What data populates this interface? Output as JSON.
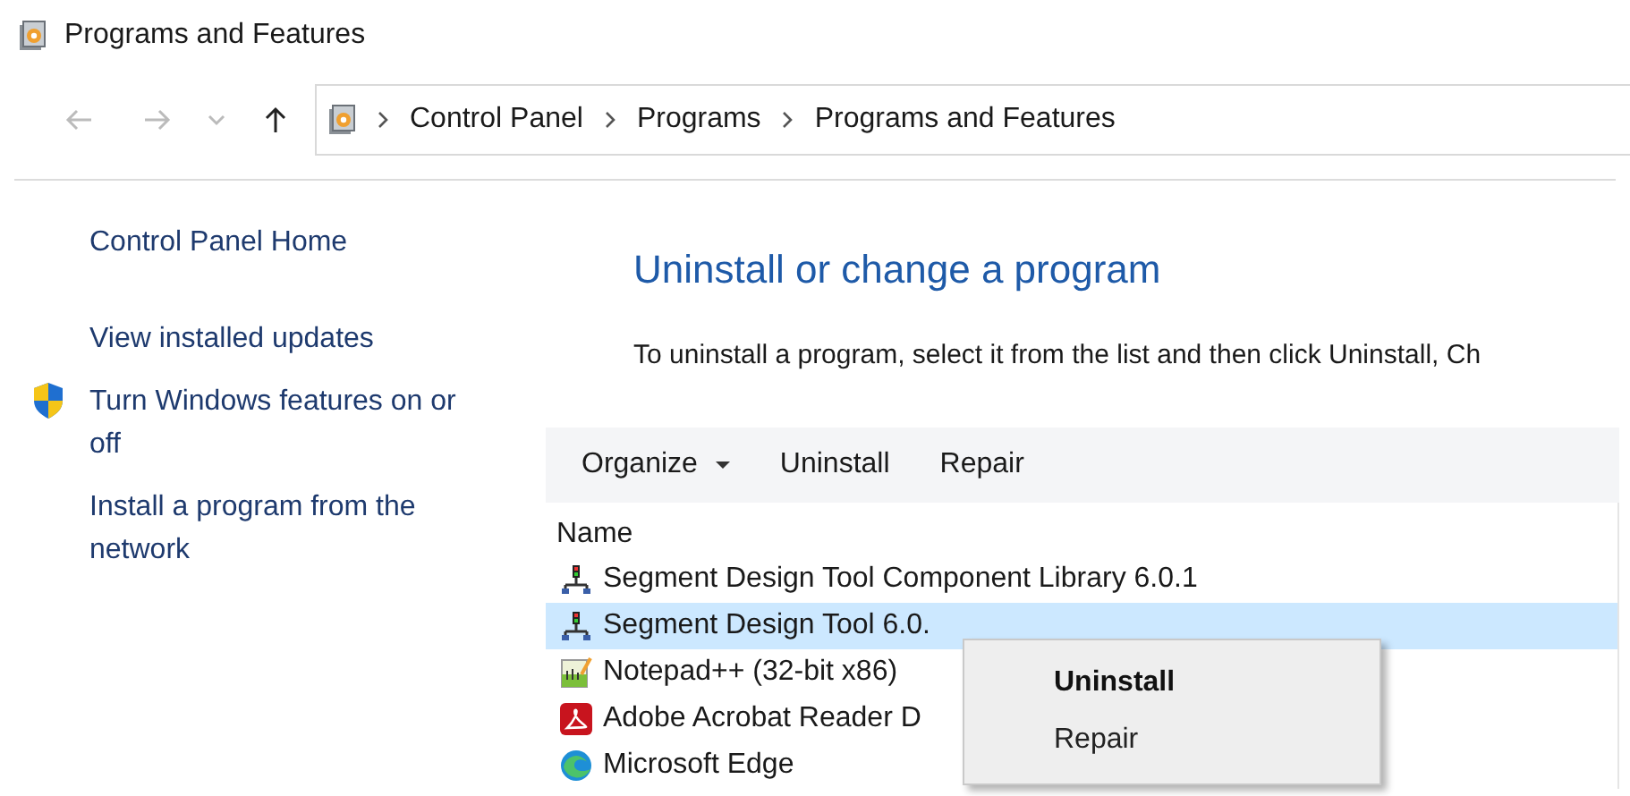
{
  "window": {
    "title": "Programs and Features"
  },
  "address_bar": {
    "breadcrumbs": [
      "Control Panel",
      "Programs",
      "Programs and Features"
    ]
  },
  "sidebar": {
    "items": [
      {
        "label": "Control Panel Home",
        "kind": "link"
      },
      {
        "label": "View installed updates",
        "kind": "link"
      },
      {
        "label": "Turn Windows features on or off",
        "kind": "shield"
      },
      {
        "label": "Install a program from the network",
        "kind": "link"
      }
    ]
  },
  "heading": "Uninstall or change a program",
  "description": "To uninstall a program, select it from the list and then click Uninstall, Ch",
  "toolbar": {
    "buttons": [
      {
        "label": "Organize",
        "kind": "dropdown"
      },
      {
        "label": "Uninstall",
        "kind": "plain"
      },
      {
        "label": "Repair",
        "kind": "plain"
      }
    ]
  },
  "table": {
    "columns": [
      "Name"
    ],
    "rows": [
      {
        "name": "Segment Design Tool Component Library 6.0.1",
        "kind": "segment",
        "selected": false
      },
      {
        "name": "Segment Design Tool 6.0.",
        "kind": "segment",
        "selected": true
      },
      {
        "name": "Notepad++ (32-bit x86)",
        "kind": "notepad",
        "selected": false
      },
      {
        "name": "Adobe Acrobat Reader D",
        "kind": "pdf",
        "selected": false
      },
      {
        "name": "Microsoft Edge",
        "kind": "edge",
        "selected": false
      }
    ]
  },
  "context_menu": {
    "items": [
      {
        "label": "Uninstall",
        "default": true
      },
      {
        "label": "Repair",
        "default": false
      }
    ]
  }
}
